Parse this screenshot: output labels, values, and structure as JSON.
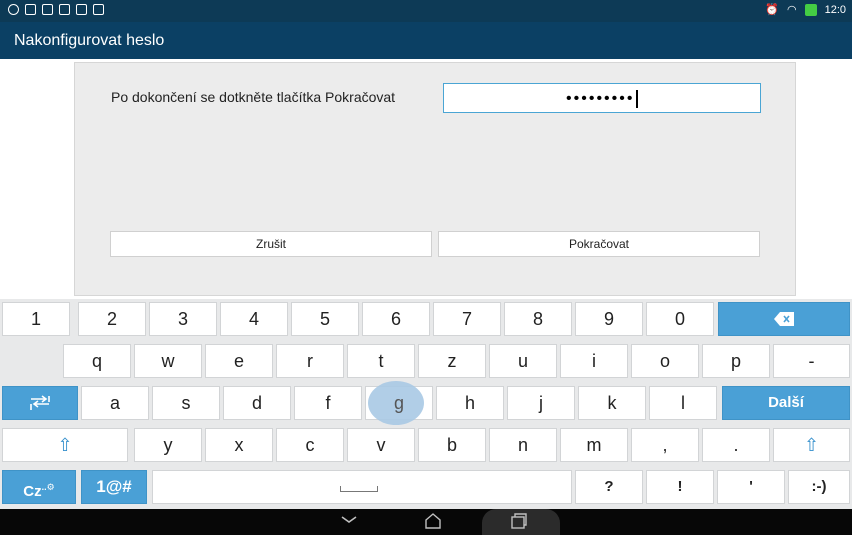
{
  "status": {
    "time": "12:0"
  },
  "title": "Nakonfigurovat heslo",
  "dialog": {
    "instruction": "Po dokončení se dotkněte tlačítka Pokračovat",
    "password_masked": "•••••••••",
    "cancel_label": "Zrušit",
    "continue_label": "Pokračovat"
  },
  "keyboard": {
    "row1": [
      "1",
      "2",
      "3",
      "4",
      "5",
      "6",
      "7",
      "8",
      "9",
      "0"
    ],
    "row2": [
      "q",
      "w",
      "e",
      "r",
      "t",
      "z",
      "u",
      "i",
      "o",
      "p",
      "-"
    ],
    "row3": [
      "a",
      "s",
      "d",
      "f",
      "g",
      "h",
      "j",
      "k",
      "l"
    ],
    "next_label": "Další",
    "row4": [
      "y",
      "x",
      "c",
      "v",
      "b",
      "n",
      "m",
      ",",
      "."
    ],
    "lang_label": "Cz",
    "symbols_label": "1@#",
    "punct": [
      "?",
      "!",
      "'",
      ":-)"
    ]
  },
  "colors": {
    "accent": "#4aa0d6",
    "title_bar": "#0b4064",
    "status_bar": "#0d3a56"
  },
  "icons": [
    "backspace-icon",
    "tab-icon",
    "shift-icon",
    "space-icon",
    "back-nav-icon",
    "home-nav-icon",
    "recents-nav-icon"
  ]
}
